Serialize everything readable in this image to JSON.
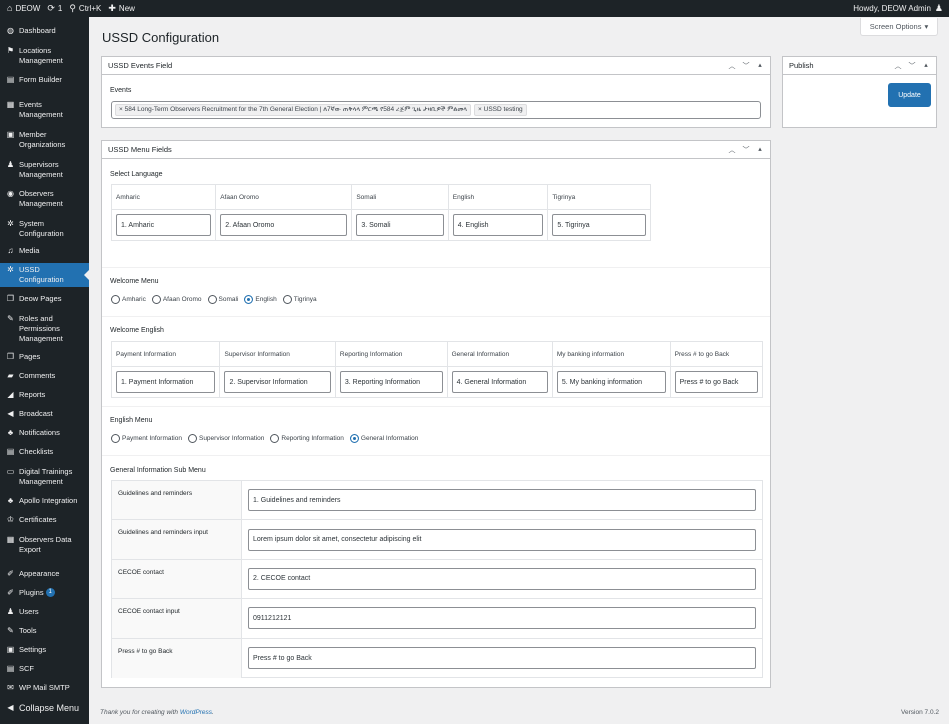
{
  "adminbar": {
    "site": "DEOW",
    "updates": "1",
    "search": "Ctrl+K",
    "new": "New",
    "howdy": "Howdy, DEOW Admin"
  },
  "sidebar": {
    "items": [
      {
        "label": "Dashboard",
        "icon": "dashboard-icon",
        "glyph": "◍"
      },
      {
        "label": "Locations Management",
        "icon": "locations-icon",
        "glyph": "⚑"
      },
      {
        "label": "Form Builder",
        "icon": "form-icon",
        "glyph": "▤"
      },
      {
        "label": "Events Management",
        "icon": "calendar-icon",
        "glyph": "▦"
      },
      {
        "label": "Member Organizations",
        "icon": "organizations-icon",
        "glyph": "▣"
      },
      {
        "label": "Supervisors Management",
        "icon": "supervisors-icon",
        "glyph": "♟"
      },
      {
        "label": "Observers Management",
        "icon": "observers-icon",
        "glyph": "◉"
      },
      {
        "label": "System Configuration",
        "icon": "gear-icon",
        "glyph": "✲"
      },
      {
        "label": "Media",
        "icon": "media-icon",
        "glyph": "♫"
      },
      {
        "label": "USSD Configuration",
        "icon": "gear-icon",
        "glyph": "✲"
      },
      {
        "label": "Deow Pages",
        "icon": "pages-icon",
        "glyph": "❐"
      },
      {
        "label": "Roles and Permissions Management",
        "icon": "wrench-icon",
        "glyph": "✎"
      },
      {
        "label": "Pages",
        "icon": "pages-icon",
        "glyph": "❐"
      },
      {
        "label": "Comments",
        "icon": "comments-icon",
        "glyph": "▰"
      },
      {
        "label": "Reports",
        "icon": "reports-icon",
        "glyph": "◢"
      },
      {
        "label": "Broadcast",
        "icon": "megaphone-icon",
        "glyph": "◀"
      },
      {
        "label": "Notifications",
        "icon": "bell-icon",
        "glyph": "♣"
      },
      {
        "label": "Checklists",
        "icon": "checklist-icon",
        "glyph": "▤"
      },
      {
        "label": "Digital Trainings Management",
        "icon": "training-icon",
        "glyph": "▭"
      },
      {
        "label": "Apollo Integration",
        "icon": "integration-icon",
        "glyph": "♣"
      },
      {
        "label": "Certificates",
        "icon": "certificate-icon",
        "glyph": "♔"
      },
      {
        "label": "Observers Data Export",
        "icon": "export-icon",
        "glyph": "▦"
      },
      {
        "label": "Appearance",
        "icon": "appearance-icon",
        "glyph": "✐"
      },
      {
        "label": "Plugins",
        "icon": "plugins-icon",
        "glyph": "✐",
        "badge": "1"
      },
      {
        "label": "Users",
        "icon": "users-icon",
        "glyph": "♟"
      },
      {
        "label": "Tools",
        "icon": "tools-icon",
        "glyph": "✎"
      },
      {
        "label": "Settings",
        "icon": "settings-icon",
        "glyph": "▣"
      },
      {
        "label": "SCF",
        "icon": "scf-icon",
        "glyph": "▤"
      },
      {
        "label": "WP Mail SMTP",
        "icon": "mail-icon",
        "glyph": "✉"
      },
      {
        "label": "Collapse Menu",
        "icon": "collapse-icon",
        "glyph": "◀"
      }
    ]
  },
  "screen_options": "Screen Options",
  "page_title": "USSD Configuration",
  "events_box": {
    "title": "USSD Events Field",
    "label": "Events",
    "tags": [
      "584 Long-Term Observers Recruitment for the 7th General Election | ለ7ኛው ጠቅላላ ምርጫ የ584 ረጅም ጊዜ ታዛቢዎች ምልመላ",
      "USSD testing"
    ]
  },
  "menu_box": {
    "title": "USSD Menu Fields",
    "select_language": {
      "label": "Select Language",
      "headers": [
        "Amharic",
        "Afaan Oromo",
        "Somali",
        "English",
        "Tigrinya"
      ],
      "values": [
        "1. Amharic",
        "2. Afaan Oromo",
        "3. Somali",
        "4. English",
        "5. Tigrinya"
      ]
    },
    "welcome_menu": {
      "label": "Welcome Menu",
      "options": [
        "Amharic",
        "Afaan Oromo",
        "Somali",
        "English",
        "Tigrinya"
      ],
      "selected": "English"
    },
    "welcome_english": {
      "label": "Welcome English",
      "headers": [
        "Payment Information",
        "Supervisor Information",
        "Reporting Information",
        "General Information",
        "My banking information",
        "Press # to go Back"
      ],
      "values": [
        "1. Payment Information",
        "2. Supervisor Information",
        "3. Reporting Information",
        "4. General Information",
        "5. My banking information",
        "Press # to go Back"
      ]
    },
    "english_menu": {
      "label": "English Menu",
      "options": [
        "Payment Information",
        "Supervisor Information",
        "Reporting Information",
        "General Information"
      ],
      "selected": "General Information"
    },
    "general_sub_menu": {
      "label": "General Information Sub Menu",
      "rows": [
        {
          "label": "Guidelines and reminders",
          "value": "1. Guidelines and reminders"
        },
        {
          "label": "Guidelines and reminders input",
          "value": "Lorem ipsum dolor sit amet, consectetur adipiscing elit"
        },
        {
          "label": "CECOE contact",
          "value": "2. CECOE contact"
        },
        {
          "label": "CECOE contact input",
          "value": "0911212121"
        },
        {
          "label": "Press # to go Back",
          "value": "Press # to go Back"
        }
      ]
    }
  },
  "publish_box": {
    "title": "Publish",
    "button": "Update"
  },
  "footer": {
    "thanks": "Thank you for creating with",
    "link": "WordPress",
    "period": ".",
    "version": "Version 7.0.2"
  },
  "colors": {
    "admin_dark": "#1d2327",
    "accent": "#2271b1",
    "background": "#f0f0f1"
  }
}
